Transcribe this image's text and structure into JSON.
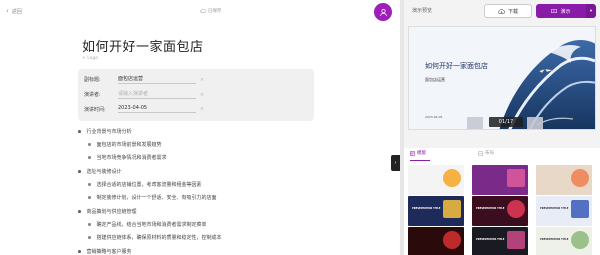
{
  "header": {
    "back_label": "返回",
    "saved_label": "已保存"
  },
  "document": {
    "title": "如何开好一家面包店",
    "logo_hint": "+ Logo",
    "meta": [
      {
        "label": "副标题:",
        "value": "面包店运营",
        "placeholder": false
      },
      {
        "label": "演讲者:",
        "value": "请输入演讲者",
        "placeholder": true
      },
      {
        "label": "演讲时间:",
        "value": "2023-04-05",
        "placeholder": false
      }
    ],
    "clear_glyph": "×"
  },
  "outline": [
    {
      "level": 1,
      "text": "行业背景与市场分析"
    },
    {
      "level": 2,
      "text": "面包店的市场前景和发展趋势"
    },
    {
      "level": 2,
      "text": "当地市场竞争情况和消费者需求"
    },
    {
      "level": 1,
      "text": "选址与装修设计"
    },
    {
      "level": 2,
      "text": "选择合适的店铺位置，考虑客流量和租金等因素"
    },
    {
      "level": 2,
      "text": "制定装修计划，设计一个舒适、安全、有吸引力的店面"
    },
    {
      "level": 1,
      "text": "商品策划与供应链管理"
    },
    {
      "level": 2,
      "text": "确定产品线，结合当地市场和消费者需求制定菜单"
    },
    {
      "level": 2,
      "text": "搭建供应链体系，确保原材料的质量和稳定性，控制成本"
    },
    {
      "level": 1,
      "text": "营销策略与客户服务"
    }
  ],
  "panel": {
    "preview_label": "演示预览",
    "download_label": "下载",
    "present_label": "演示",
    "slide": {
      "title": "如何开好一家面包店",
      "subtitle": "面包店运营",
      "date": "2023-04-05",
      "counter": "01/17"
    },
    "tabs": [
      {
        "label": "模版",
        "active": true
      },
      {
        "label": "布局",
        "active": false
      }
    ],
    "template_thumbs": [
      {
        "name": "orange-circle",
        "bg": "#f4f4f4",
        "accent": "#f5a623",
        "text": "",
        "dark": true
      },
      {
        "name": "purple-pink",
        "bg": "#7a2a88",
        "accent": "#e05a9c",
        "text": "",
        "dark": false
      },
      {
        "name": "gradient-warm",
        "bg": "#e8d8c8",
        "accent": "#f08050",
        "text": "",
        "dark": true
      },
      {
        "name": "navy-title",
        "bg": "#1e2a5a",
        "accent": "#f6c23e",
        "text": "PRESENTATION TITLE",
        "dark": false
      },
      {
        "name": "dark-red",
        "bg": "#3a0e1e",
        "accent": "#e63a5a",
        "text": "PRESENTATION TITLE",
        "dark": false
      },
      {
        "name": "white-blue",
        "bg": "#e8ecf6",
        "accent": "#3a5ab8",
        "text": "PRESENTATION TITLE",
        "dark": true
      },
      {
        "name": "red-dark",
        "bg": "#2a0a0a",
        "accent": "#d83030",
        "text": "",
        "dark": false
      },
      {
        "name": "black-card",
        "bg": "#1a1a22",
        "accent": "#d04a8a",
        "text": "PRESENTATION TITLE",
        "dark": false
      },
      {
        "name": "light-green",
        "bg": "#eef0ea",
        "accent": "#8ab878",
        "text": "PRESENTATION TITLE",
        "dark": true
      }
    ]
  }
}
